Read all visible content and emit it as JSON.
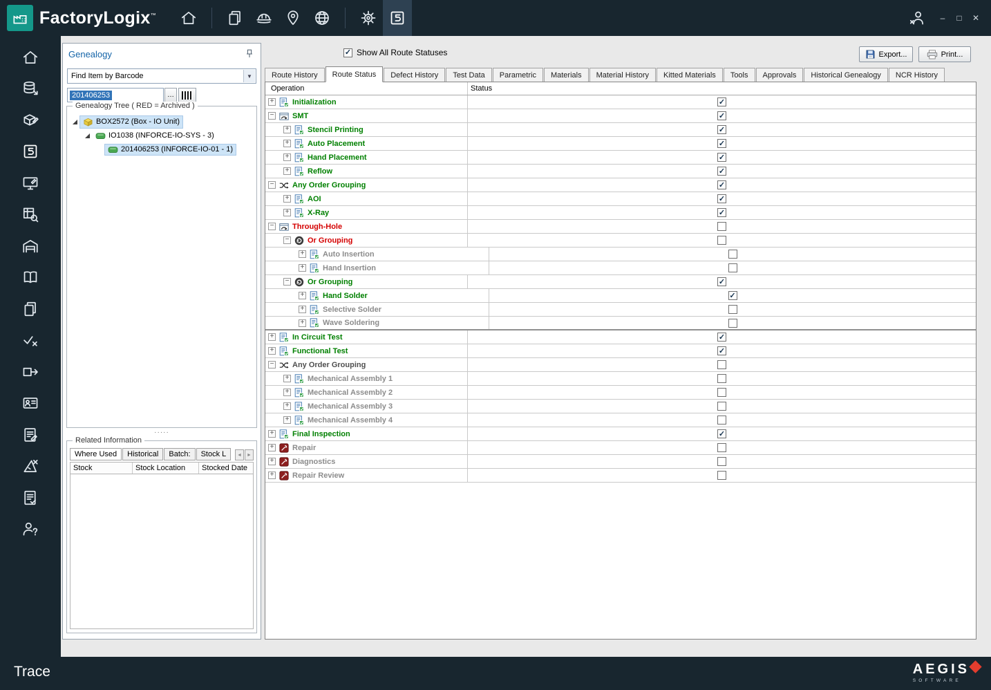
{
  "colors": {
    "titlebar_bg": "#18262f",
    "accent_teal": "#14988a",
    "status_green": "#008000",
    "status_red": "#d40000",
    "muted_gray": "#8c8c8c",
    "selection_blue": "#cde4f7",
    "brand_red": "#e23d2e"
  },
  "titlebar": {
    "app_name": "FactoryLogix",
    "trademark": "™",
    "nav_icons": [
      {
        "name": "home-icon"
      },
      {
        "name": "documents-icon",
        "sep_before": true
      },
      {
        "name": "hardhat-icon"
      },
      {
        "name": "location-pin-icon"
      },
      {
        "name": "globe-icon"
      },
      {
        "name": "settings-gear-icon",
        "sep_before": true
      },
      {
        "name": "trace-module-icon",
        "active": true
      }
    ],
    "user_icon": "user-logout-icon",
    "window_controls": [
      {
        "name": "minimize-button",
        "glyph": "–"
      },
      {
        "name": "maximize-button",
        "glyph": "□"
      },
      {
        "name": "close-button",
        "glyph": "✕"
      }
    ]
  },
  "sidebar": {
    "items": [
      {
        "id": "home",
        "icon": "home-icon"
      },
      {
        "id": "production",
        "icon": "production-icon"
      },
      {
        "id": "materials",
        "icon": "materials-icon"
      },
      {
        "id": "trace",
        "icon": "trace-module-icon"
      },
      {
        "id": "station",
        "icon": "station-icon"
      },
      {
        "id": "data-query",
        "icon": "data-query-icon"
      },
      {
        "id": "warehouse",
        "icon": "warehouse-icon"
      },
      {
        "id": "documentation",
        "icon": "docs-book-icon"
      },
      {
        "id": "copy",
        "icon": "copy-pages-icon"
      },
      {
        "id": "quality",
        "icon": "quality-icon"
      },
      {
        "id": "transfer",
        "icon": "transfer-icon"
      },
      {
        "id": "badge",
        "icon": "badge-icon"
      },
      {
        "id": "worksheet",
        "icon": "worksheet-icon"
      },
      {
        "id": "design",
        "icon": "design-icon"
      },
      {
        "id": "report",
        "icon": "report-icon"
      },
      {
        "id": "support",
        "icon": "support-icon"
      }
    ]
  },
  "left_panel": {
    "title": "Genealogy",
    "search_mode": "Find Item by Barcode",
    "barcode_value": "201406253",
    "browse_label": "…",
    "tree_group_title": "Genealogy Tree ( RED = Archived )",
    "tree": [
      {
        "label": "BOX2572 (Box - IO Unit)",
        "level": 0,
        "icon": "box-icon",
        "expanded": true,
        "highlight": true
      },
      {
        "label": "IO1038 (INFORCE-IO-SYS - 3)",
        "level": 1,
        "icon": "board-icon",
        "expanded": true,
        "highlight": false
      },
      {
        "label": "201406253 (INFORCE-IO-01 - 1)",
        "level": 2,
        "icon": "board-icon",
        "expanded": false,
        "highlight": true
      }
    ],
    "splitter_dots": "·····",
    "related_title": "Related Information",
    "related_tabs": [
      "Where Used",
      "Historical",
      "Batch:",
      "Stock L"
    ],
    "related_columns": [
      "Stock",
      "Stock Location",
      "Stocked Date"
    ]
  },
  "main": {
    "show_all_label": "Show All Route Statuses",
    "show_all_checked": true,
    "export_label": "Export...",
    "print_label": "Print...",
    "tabs": [
      {
        "label": "Route History"
      },
      {
        "label": "Route Status",
        "active": true
      },
      {
        "label": "Defect History"
      },
      {
        "label": "Test Data"
      },
      {
        "label": "Parametric"
      },
      {
        "label": "Materials"
      },
      {
        "label": "Material History"
      },
      {
        "label": "Kitted Materials"
      },
      {
        "label": "Tools"
      },
      {
        "label": "Approvals"
      },
      {
        "label": "Historical Genealogy"
      },
      {
        "label": "NCR History"
      }
    ],
    "grid": {
      "columns": [
        "Operation",
        "Status"
      ],
      "rows": [
        {
          "label": "Initialization",
          "level": 0,
          "exp": "plus",
          "icon": "operation-icon",
          "color": "green",
          "checked": true
        },
        {
          "label": "SMT",
          "level": 0,
          "exp": "minus",
          "icon": "route-group-icon",
          "color": "green",
          "checked": true
        },
        {
          "label": "Stencil Printing",
          "level": 1,
          "exp": "plus",
          "icon": "operation-icon",
          "color": "green",
          "checked": true
        },
        {
          "label": "Auto Placement",
          "level": 1,
          "exp": "plus",
          "icon": "operation-icon",
          "color": "green",
          "checked": true
        },
        {
          "label": "Hand Placement",
          "level": 1,
          "exp": "plus",
          "icon": "operation-icon",
          "color": "green",
          "checked": true
        },
        {
          "label": "Reflow",
          "level": 1,
          "exp": "plus",
          "icon": "operation-icon",
          "color": "green",
          "checked": true
        },
        {
          "label": "Any Order Grouping",
          "level": 0,
          "exp": "minus",
          "icon": "any-order-icon",
          "color": "green",
          "checked": true
        },
        {
          "label": "AOI",
          "level": 1,
          "exp": "plus",
          "icon": "operation-icon",
          "color": "green",
          "checked": true
        },
        {
          "label": "X-Ray",
          "level": 1,
          "exp": "plus",
          "icon": "operation-icon",
          "color": "green",
          "checked": true
        },
        {
          "label": "Through-Hole",
          "level": 0,
          "exp": "minus",
          "icon": "route-group-icon",
          "color": "red",
          "checked": false
        },
        {
          "label": "Or Grouping",
          "level": 1,
          "exp": "minus",
          "icon": "or-group-icon",
          "color": "red",
          "checked": false
        },
        {
          "label": "Auto Insertion",
          "level": 2,
          "exp": "plus",
          "icon": "operation-icon",
          "color": "gray",
          "checked": false,
          "deep": true
        },
        {
          "label": "Hand Insertion",
          "level": 2,
          "exp": "plus",
          "icon": "operation-icon",
          "color": "gray",
          "checked": false,
          "deep": true
        },
        {
          "label": "Or Grouping",
          "level": 1,
          "exp": "minus",
          "icon": "or-group-icon",
          "color": "green",
          "checked": true
        },
        {
          "label": "Hand Solder",
          "level": 2,
          "exp": "plus",
          "icon": "operation-icon",
          "color": "green",
          "checked": true,
          "deep": true
        },
        {
          "label": "Selective Solder",
          "level": 2,
          "exp": "plus",
          "icon": "operation-icon",
          "color": "gray",
          "checked": false,
          "deep": true
        },
        {
          "label": "Wave Soldering",
          "level": 2,
          "exp": "plus",
          "icon": "operation-icon",
          "color": "gray",
          "checked": false,
          "deep": true,
          "section_end": true
        },
        {
          "label": "In Circuit Test",
          "level": 0,
          "exp": "plus",
          "icon": "operation-icon",
          "color": "green",
          "checked": true
        },
        {
          "label": "Functional Test",
          "level": 0,
          "exp": "plus",
          "icon": "operation-icon",
          "color": "green",
          "checked": true
        },
        {
          "label": "Any Order Grouping",
          "level": 0,
          "exp": "minus",
          "icon": "any-order-icon",
          "color": "dark",
          "checked": false
        },
        {
          "label": "Mechanical Assembly 1",
          "level": 1,
          "exp": "plus",
          "icon": "operation-icon",
          "color": "gray",
          "checked": false
        },
        {
          "label": "Mechanical Assembly 2",
          "level": 1,
          "exp": "plus",
          "icon": "operation-icon",
          "color": "gray",
          "checked": false
        },
        {
          "label": "Mechanical Assembly 3",
          "level": 1,
          "exp": "plus",
          "icon": "operation-icon",
          "color": "gray",
          "checked": false
        },
        {
          "label": "Mechanical Assembly 4",
          "level": 1,
          "exp": "plus",
          "icon": "operation-icon",
          "color": "gray",
          "checked": false
        },
        {
          "label": "Final Inspection",
          "level": 0,
          "exp": "plus",
          "icon": "operation-icon",
          "color": "green",
          "checked": true
        },
        {
          "label": "Repair",
          "level": 0,
          "exp": "plus",
          "icon": "repair-icon",
          "color": "gray",
          "checked": false
        },
        {
          "label": "Diagnostics",
          "level": 0,
          "exp": "plus",
          "icon": "repair-icon",
          "color": "gray",
          "checked": false
        },
        {
          "label": "Repair Review",
          "level": 0,
          "exp": "plus",
          "icon": "repair-icon",
          "color": "gray",
          "checked": false
        }
      ]
    }
  },
  "statusbar": {
    "mode_label": "Trace",
    "brand": "AEGIS",
    "brand_sub": "SOFTWARE"
  }
}
